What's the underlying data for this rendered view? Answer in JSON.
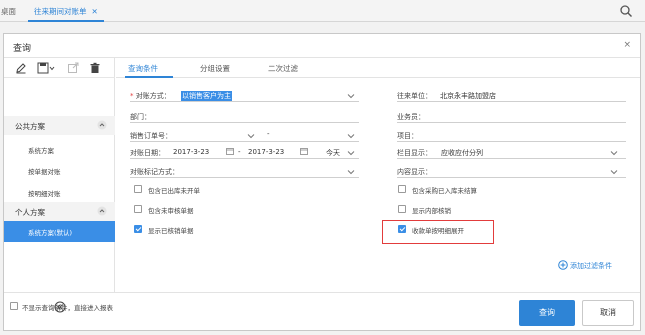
{
  "topbar": {
    "desktop_tab": "桌面",
    "active_tab": "往来期间对账单",
    "close_glyph": "✕"
  },
  "dialog": {
    "title": "查询",
    "close_glyph": "×"
  },
  "left_panel": {
    "public_section": "公共方案",
    "public_items": [
      "系统方案",
      "按单据对账",
      "按明细对账"
    ],
    "personal_section": "个人方案",
    "personal_selected": "系统方案(默认)"
  },
  "tabs": [
    "查询条件",
    "分组设置",
    "二次过滤"
  ],
  "form": {
    "reconcile_method_label": "对账方式：",
    "reconcile_method_value": "以销售客户为主",
    "partner_label": "往来单位：",
    "partner_value": "北京永丰路加盟店",
    "dept_label": "部门：",
    "salesman_label": "业务员：",
    "sales_order_label": "销售订单号：",
    "range_dash": "-",
    "project_label": "项目：",
    "date_label": "对账日期：",
    "date_from": "2017-3-23",
    "date_to": "2017-3-23",
    "date_quick": "今天",
    "column_display_label": "栏目显示：",
    "column_display_value": "应收应付分列",
    "mark_method_label": "对账标记方式：",
    "content_display_label": "内容显示："
  },
  "checkboxes_left": [
    {
      "label": "包含已出库未开单",
      "checked": false
    },
    {
      "label": "包含未审核单据",
      "checked": false
    },
    {
      "label": "显示已核销单据",
      "checked": true
    }
  ],
  "checkboxes_right": [
    {
      "label": "包含采购已入库未结算",
      "checked": false
    },
    {
      "label": "显示内部核销",
      "checked": false
    },
    {
      "label": "收款单按明细展开",
      "checked": true
    }
  ],
  "add_filter_label": "添加过滤条件",
  "footer": {
    "skip_label": "不显示查询条件，直接进入报表",
    "ok_label": "查询",
    "cancel_label": "取消"
  },
  "colors": {
    "accent": "#2e84d6",
    "highlight_box": "#e23c3c"
  }
}
